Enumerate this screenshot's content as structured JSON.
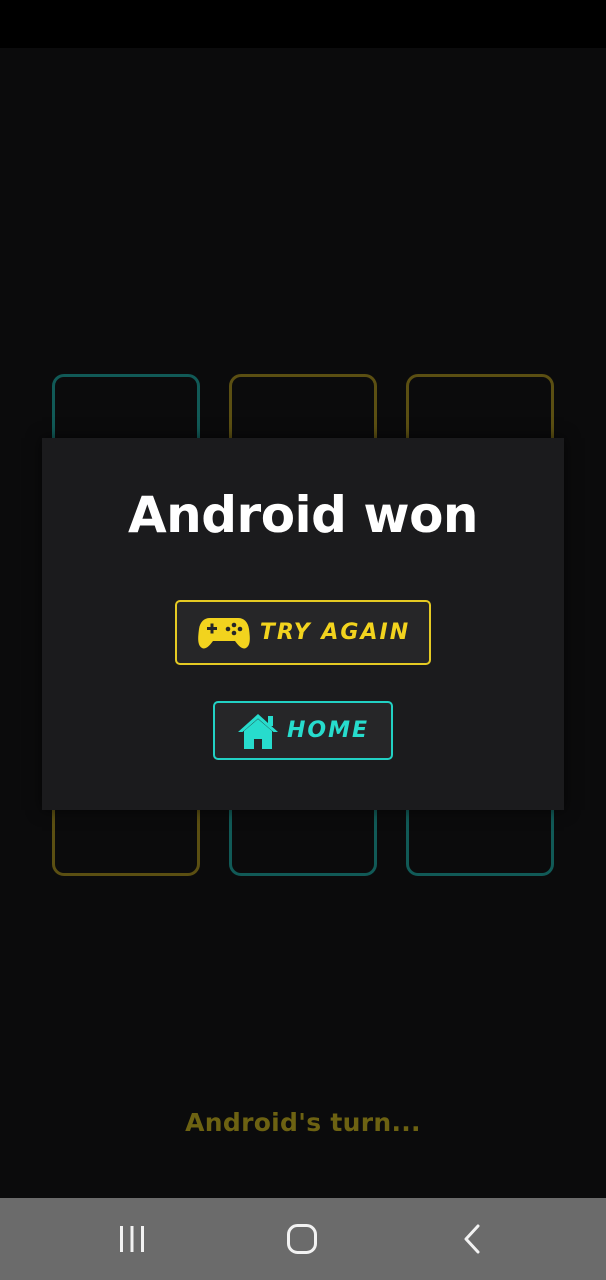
{
  "result": {
    "title": "Android won"
  },
  "buttons": {
    "try_again_label": "TRY AGAIN",
    "try_again_icon": "gamepad-icon",
    "home_label": "HOME",
    "home_icon": "home-icon"
  },
  "status": {
    "turn_text": "Android's turn..."
  },
  "board": {
    "cell_colors_top_row": [
      "teal",
      "gold",
      "gold"
    ],
    "cell_colors_bottom_row": [
      "gold",
      "teal",
      "teal"
    ]
  },
  "navigation": {
    "recents_icon": "recents-icon",
    "home_icon": "nav-home-icon",
    "back_icon": "back-icon"
  },
  "colors": {
    "background": "#0b0b0c",
    "dialog": "#1b1b1d",
    "accent_yellow": "#f2d31e",
    "accent_teal": "#27dccd",
    "nav_bar": "#6b6b6b"
  }
}
